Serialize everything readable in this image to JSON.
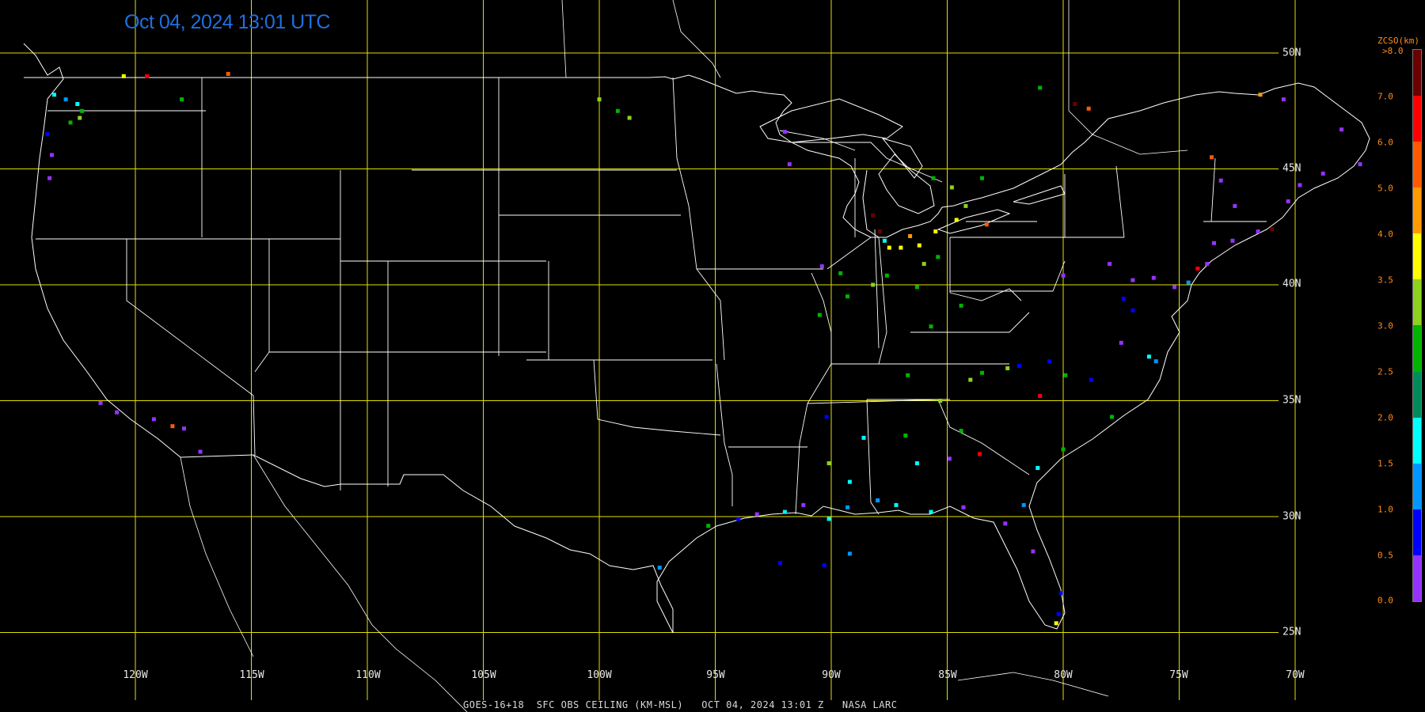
{
  "header": {
    "title": "Oct 04, 2024 13:01 UTC"
  },
  "footer": {
    "caption": "GOES-16+18  SFC OBS CEILING (KM-MSL)   OCT 04, 2024 13:01 Z   NASA LARC"
  },
  "grid": {
    "longitudes": [
      "120W",
      "115W",
      "110W",
      "105W",
      "100W",
      "95W",
      "90W",
      "85W",
      "80W",
      "75W",
      "70W"
    ],
    "latitudes": [
      "50N",
      "45N",
      "40N",
      "35N",
      "30N",
      "25N"
    ],
    "grid_color": "#e0e000",
    "border_color": "#ffffff"
  },
  "legend": {
    "title": "ZCSO(km)",
    "top_label": ">8.0",
    "ticks": [
      "7.0",
      "6.0",
      "5.0",
      "4.0",
      "3.5",
      "3.0",
      "2.5",
      "2.0",
      "1.5",
      "1.0",
      "0.5",
      "0.0"
    ],
    "colors_top_to_bottom": [
      "#6a0000",
      "#ff0000",
      "#ff5a00",
      "#ff9a00",
      "#ffff00",
      "#8cd21e",
      "#00b400",
      "#008c5a",
      "#00ffff",
      "#0096ff",
      "#0000ff",
      "#9632ff"
    ]
  },
  "observations": [
    {
      "lon": -123.5,
      "lat": 48.2,
      "color": "#00ffff"
    },
    {
      "lon": -123.0,
      "lat": 48.0,
      "color": "#0096ff"
    },
    {
      "lon": -122.5,
      "lat": 47.8,
      "color": "#00ffff"
    },
    {
      "lon": -122.3,
      "lat": 47.5,
      "color": "#00b400"
    },
    {
      "lon": -122.4,
      "lat": 47.2,
      "color": "#8cd21e"
    },
    {
      "lon": -122.8,
      "lat": 47.0,
      "color": "#00b400"
    },
    {
      "lon": -123.8,
      "lat": 46.5,
      "color": "#0000ff"
    },
    {
      "lon": -123.6,
      "lat": 45.6,
      "color": "#9632ff"
    },
    {
      "lon": -123.7,
      "lat": 44.6,
      "color": "#9632ff"
    },
    {
      "lon": -120.5,
      "lat": 49.0,
      "color": "#ffff00"
    },
    {
      "lon": -119.5,
      "lat": 49.0,
      "color": "#ff0000"
    },
    {
      "lon": -116.0,
      "lat": 49.1,
      "color": "#ff5a00"
    },
    {
      "lon": -118.0,
      "lat": 48.0,
      "color": "#00b400"
    },
    {
      "lon": -121.5,
      "lat": 34.9,
      "color": "#9632ff"
    },
    {
      "lon": -120.8,
      "lat": 34.5,
      "color": "#9632ff"
    },
    {
      "lon": -119.2,
      "lat": 34.2,
      "color": "#9632ff"
    },
    {
      "lon": -118.4,
      "lat": 33.9,
      "color": "#ff5a00"
    },
    {
      "lon": -117.9,
      "lat": 33.8,
      "color": "#9632ff"
    },
    {
      "lon": -117.2,
      "lat": 32.8,
      "color": "#9632ff"
    },
    {
      "lon": -100.0,
      "lat": 48.0,
      "color": "#8cd21e"
    },
    {
      "lon": -99.2,
      "lat": 47.5,
      "color": "#00b400"
    },
    {
      "lon": -98.7,
      "lat": 47.2,
      "color": "#8cd21e"
    },
    {
      "lon": -92.0,
      "lat": 46.6,
      "color": "#9632ff"
    },
    {
      "lon": -91.8,
      "lat": 45.2,
      "color": "#9632ff"
    },
    {
      "lon": -88.2,
      "lat": 43.0,
      "color": "#6a0000"
    },
    {
      "lon": -87.9,
      "lat": 42.3,
      "color": "#6a0000"
    },
    {
      "lon": -87.7,
      "lat": 41.9,
      "color": "#00ffff"
    },
    {
      "lon": -87.5,
      "lat": 41.6,
      "color": "#ffff00"
    },
    {
      "lon": -87.0,
      "lat": 41.6,
      "color": "#ffff00"
    },
    {
      "lon": -86.2,
      "lat": 41.7,
      "color": "#ffff00"
    },
    {
      "lon": -86.6,
      "lat": 42.1,
      "color": "#ff9a00"
    },
    {
      "lon": -85.5,
      "lat": 42.3,
      "color": "#ffff00"
    },
    {
      "lon": -84.6,
      "lat": 42.8,
      "color": "#ffff00"
    },
    {
      "lon": -83.3,
      "lat": 42.6,
      "color": "#ff5a00"
    },
    {
      "lon": -84.2,
      "lat": 43.4,
      "color": "#8cd21e"
    },
    {
      "lon": -85.6,
      "lat": 44.6,
      "color": "#00b400"
    },
    {
      "lon": -84.8,
      "lat": 44.2,
      "color": "#8cd21e"
    },
    {
      "lon": -83.5,
      "lat": 44.6,
      "color": "#00b400"
    },
    {
      "lon": -89.6,
      "lat": 40.5,
      "color": "#00b400"
    },
    {
      "lon": -88.2,
      "lat": 40.0,
      "color": "#8cd21e"
    },
    {
      "lon": -87.6,
      "lat": 40.4,
      "color": "#00b400"
    },
    {
      "lon": -86.3,
      "lat": 39.9,
      "color": "#00b400"
    },
    {
      "lon": -86.0,
      "lat": 40.9,
      "color": "#8cd21e"
    },
    {
      "lon": -85.4,
      "lat": 41.2,
      "color": "#00b400"
    },
    {
      "lon": -89.3,
      "lat": 39.5,
      "color": "#00b400"
    },
    {
      "lon": -90.4,
      "lat": 40.8,
      "color": "#9632ff"
    },
    {
      "lon": -90.5,
      "lat": 38.7,
      "color": "#00b400"
    },
    {
      "lon": -84.4,
      "lat": 39.1,
      "color": "#00b400"
    },
    {
      "lon": -85.7,
      "lat": 38.2,
      "color": "#00b400"
    },
    {
      "lon": -80.0,
      "lat": 40.4,
      "color": "#9632ff"
    },
    {
      "lon": -78.0,
      "lat": 40.9,
      "color": "#9632ff"
    },
    {
      "lon": -77.0,
      "lat": 40.2,
      "color": "#9632ff"
    },
    {
      "lon": -76.1,
      "lat": 40.3,
      "color": "#9632ff"
    },
    {
      "lon": -75.2,
      "lat": 39.9,
      "color": "#9632ff"
    },
    {
      "lon": -74.2,
      "lat": 40.7,
      "color": "#ff0000"
    },
    {
      "lon": -73.8,
      "lat": 40.9,
      "color": "#9632ff"
    },
    {
      "lon": -74.6,
      "lat": 40.1,
      "color": "#0096ff"
    },
    {
      "lon": -77.4,
      "lat": 39.4,
      "color": "#0000ff"
    },
    {
      "lon": -77.0,
      "lat": 38.9,
      "color": "#0000ff"
    },
    {
      "lon": -77.5,
      "lat": 37.5,
      "color": "#9632ff"
    },
    {
      "lon": -76.3,
      "lat": 36.9,
      "color": "#00ffff"
    },
    {
      "lon": -76.0,
      "lat": 36.7,
      "color": "#0096ff"
    },
    {
      "lon": -73.5,
      "lat": 41.8,
      "color": "#9632ff"
    },
    {
      "lon": -72.7,
      "lat": 41.9,
      "color": "#9632ff"
    },
    {
      "lon": -71.6,
      "lat": 42.3,
      "color": "#9632ff"
    },
    {
      "lon": -71.0,
      "lat": 42.4,
      "color": "#6a0000"
    },
    {
      "lon": -73.2,
      "lat": 44.5,
      "color": "#9632ff"
    },
    {
      "lon": -72.6,
      "lat": 43.4,
      "color": "#9632ff"
    },
    {
      "lon": -70.3,
      "lat": 43.6,
      "color": "#9632ff"
    },
    {
      "lon": -69.8,
      "lat": 44.3,
      "color": "#9632ff"
    },
    {
      "lon": -68.8,
      "lat": 44.8,
      "color": "#9632ff"
    },
    {
      "lon": -68.0,
      "lat": 46.7,
      "color": "#9632ff"
    },
    {
      "lon": -67.2,
      "lat": 45.2,
      "color": "#9632ff"
    },
    {
      "lon": -73.6,
      "lat": 45.5,
      "color": "#ff5a00"
    },
    {
      "lon": -71.5,
      "lat": 48.2,
      "color": "#ff9a00"
    },
    {
      "lon": -70.5,
      "lat": 48.0,
      "color": "#9632ff"
    },
    {
      "lon": -79.5,
      "lat": 47.8,
      "color": "#6a0000"
    },
    {
      "lon": -78.9,
      "lat": 47.6,
      "color": "#ff5a00"
    },
    {
      "lon": -81.0,
      "lat": 48.5,
      "color": "#00b400"
    },
    {
      "lon": -80.6,
      "lat": 36.7,
      "color": "#0000ff"
    },
    {
      "lon": -81.9,
      "lat": 36.5,
      "color": "#0000ff"
    },
    {
      "lon": -82.4,
      "lat": 36.4,
      "color": "#8cd21e"
    },
    {
      "lon": -83.5,
      "lat": 36.2,
      "color": "#00b400"
    },
    {
      "lon": -84.0,
      "lat": 35.9,
      "color": "#8cd21e"
    },
    {
      "lon": -85.3,
      "lat": 35.0,
      "color": "#8cd21e"
    },
    {
      "lon": -86.7,
      "lat": 36.1,
      "color": "#00b400"
    },
    {
      "lon": -79.9,
      "lat": 36.1,
      "color": "#00b400"
    },
    {
      "lon": -81.0,
      "lat": 35.2,
      "color": "#ff0000"
    },
    {
      "lon": -78.8,
      "lat": 35.9,
      "color": "#0000ff"
    },
    {
      "lon": -77.9,
      "lat": 34.3,
      "color": "#00b400"
    },
    {
      "lon": -80.0,
      "lat": 32.9,
      "color": "#00b400"
    },
    {
      "lon": -81.1,
      "lat": 32.1,
      "color": "#00ffff"
    },
    {
      "lon": -81.7,
      "lat": 30.5,
      "color": "#0096ff"
    },
    {
      "lon": -82.5,
      "lat": 29.7,
      "color": "#9632ff"
    },
    {
      "lon": -81.3,
      "lat": 28.5,
      "color": "#9632ff"
    },
    {
      "lon": -80.2,
      "lat": 25.8,
      "color": "#0000ff"
    },
    {
      "lon": -80.3,
      "lat": 25.4,
      "color": "#ffff00"
    },
    {
      "lon": -80.1,
      "lat": 26.7,
      "color": "#0000ff"
    },
    {
      "lon": -84.4,
      "lat": 33.7,
      "color": "#00b400"
    },
    {
      "lon": -83.6,
      "lat": 32.7,
      "color": "#ff0000"
    },
    {
      "lon": -84.9,
      "lat": 32.5,
      "color": "#9632ff"
    },
    {
      "lon": -86.8,
      "lat": 33.5,
      "color": "#00b400"
    },
    {
      "lon": -86.3,
      "lat": 32.3,
      "color": "#00ffff"
    },
    {
      "lon": -88.0,
      "lat": 30.7,
      "color": "#0096ff"
    },
    {
      "lon": -87.2,
      "lat": 30.5,
      "color": "#00ffff"
    },
    {
      "lon": -85.7,
      "lat": 30.2,
      "color": "#00ffff"
    },
    {
      "lon": -84.3,
      "lat": 30.4,
      "color": "#9632ff"
    },
    {
      "lon": -89.3,
      "lat": 30.4,
      "color": "#0096ff"
    },
    {
      "lon": -90.1,
      "lat": 29.9,
      "color": "#00ffff"
    },
    {
      "lon": -91.2,
      "lat": 30.5,
      "color": "#9632ff"
    },
    {
      "lon": -92.0,
      "lat": 30.2,
      "color": "#00ffff"
    },
    {
      "lon": -93.2,
      "lat": 30.1,
      "color": "#9632ff"
    },
    {
      "lon": -94.0,
      "lat": 29.9,
      "color": "#0000ff"
    },
    {
      "lon": -95.3,
      "lat": 29.6,
      "color": "#00b400"
    },
    {
      "lon": -97.4,
      "lat": 27.8,
      "color": "#0096ff"
    },
    {
      "lon": -90.1,
      "lat": 32.3,
      "color": "#8cd21e"
    },
    {
      "lon": -89.2,
      "lat": 31.5,
      "color": "#00ffff"
    },
    {
      "lon": -88.6,
      "lat": 33.4,
      "color": "#00ffff"
    },
    {
      "lon": -90.2,
      "lat": 34.3,
      "color": "#0000ff"
    },
    {
      "lon": -92.2,
      "lat": 28.0,
      "color": "#0000ff"
    },
    {
      "lon": -90.3,
      "lat": 27.9,
      "color": "#0000ff"
    },
    {
      "lon": -89.2,
      "lat": 28.4,
      "color": "#0096ff"
    }
  ]
}
